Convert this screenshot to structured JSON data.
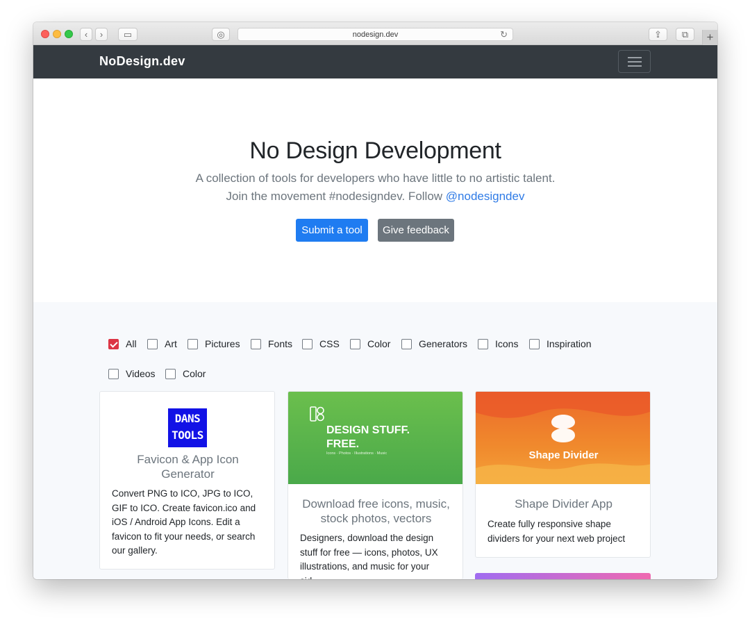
{
  "browser": {
    "url": "nodesign.dev",
    "back_glyph": "‹",
    "forward_glyph": "›",
    "sidebar_glyph": "▭",
    "privacy_glyph": "◎",
    "reload_glyph": "↻",
    "share_glyph": "⇪",
    "tabs_glyph": "⧉",
    "newtab_glyph": "+"
  },
  "navbar": {
    "brand": "NoDesign.dev"
  },
  "hero": {
    "title": "No Design Development",
    "lead_line1": "A collection of tools for developers who have little to no artistic talent.",
    "lead_line2_prefix": "Join the movement #nodesigndev. Follow ",
    "follow_handle": "@nodesigndev",
    "submit_label": "Submit a tool",
    "feedback_label": "Give feedback"
  },
  "filters": [
    {
      "label": "All",
      "checked": true
    },
    {
      "label": "Art",
      "checked": false
    },
    {
      "label": "Pictures",
      "checked": false
    },
    {
      "label": "Fonts",
      "checked": false
    },
    {
      "label": "CSS",
      "checked": false
    },
    {
      "label": "Color",
      "checked": false
    },
    {
      "label": "Generators",
      "checked": false
    },
    {
      "label": "Icons",
      "checked": false
    },
    {
      "label": "Inspiration",
      "checked": false
    },
    {
      "label": "Videos",
      "checked": false
    },
    {
      "label": "Color",
      "checked": false
    }
  ],
  "cards": [
    {
      "logo_line1": "DANS",
      "logo_line2": "TOOLS",
      "title_line1": "Favicon & App Icon",
      "title_line2": "Generator",
      "description_lines": [
        "Convert PNG to ICO, JPG to ICO,",
        "GIF to ICO. Create favicon.ico and",
        "iOS / Android App Icons. Edit a",
        "favicon to fit your needs, or search",
        "our gallery."
      ]
    },
    {
      "banner_line1": "DESIGN STUFF.",
      "banner_line2": "FREE.",
      "banner_sub": "Icons · Photos · Illustrations · Music",
      "title_line1": "Download free icons, music,",
      "title_line2": "stock photos, vectors",
      "description_lines": [
        "Designers, download the design",
        "stuff for free — icons, photos, UX",
        "illustrations, and music for your",
        "sid"
      ]
    },
    {
      "banner_text": "Shape Divider",
      "title": "Shape Divider App",
      "description_lines": [
        "Create fully responsive shape",
        "dividers for your next web project"
      ]
    }
  ],
  "colors": {
    "navbar_bg": "#343a40",
    "primary": "#1f7cf1",
    "secondary": "#6c757d",
    "checked": "#dc3545",
    "link": "#2f7be6"
  }
}
